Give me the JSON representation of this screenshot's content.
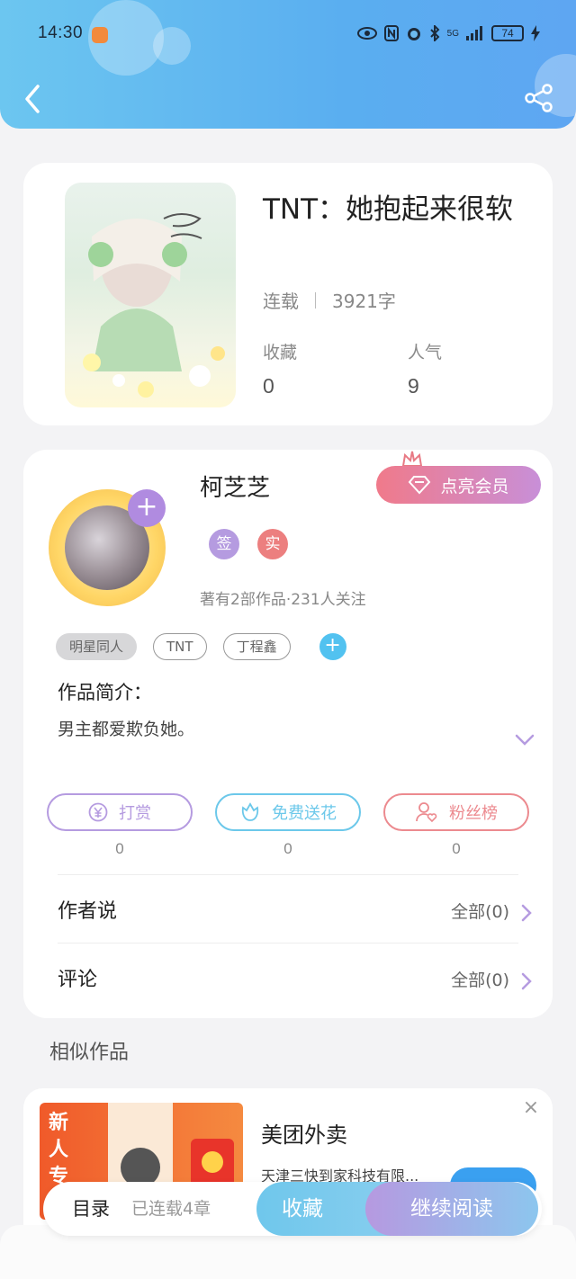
{
  "status_bar": {
    "time": "14:30",
    "network": "5G",
    "battery": "74"
  },
  "book": {
    "title": "TNT：她抱起来很软",
    "status": "连载",
    "word_count": "3921字",
    "collect_label": "收藏",
    "collect_value": "0",
    "popularity_label": "人气",
    "popularity_value": "9"
  },
  "author": {
    "name": "柯芝芝",
    "member_button": "点亮会员",
    "badge_sign": "签",
    "badge_real": "实",
    "stats": "著有2部作品·231人关注",
    "tags": [
      "明星同人",
      "TNT",
      "丁程鑫"
    ],
    "intro_title": "作品简介：",
    "intro_text": "男主都爱欺负她。"
  },
  "actions": [
    {
      "label": "打赏",
      "count": "0",
      "color": "#b59be0"
    },
    {
      "label": "免费送花",
      "count": "0",
      "color": "#6cc8ea"
    },
    {
      "label": "粉丝榜",
      "count": "0",
      "color": "#ec8a8f"
    }
  ],
  "rows": {
    "author_says": {
      "label": "作者说",
      "value": "全部(0)"
    },
    "comments": {
      "label": "评论",
      "value": "全部(0)"
    }
  },
  "similar": {
    "title": "相似作品"
  },
  "ad": {
    "title": "美团外卖",
    "subtitle": "天津三快到家科技有限...",
    "promo": "新人专"
  },
  "bottom": {
    "catalog": "目录",
    "chapters": "已连载4章",
    "favorite": "收藏",
    "continue": "继续阅读"
  },
  "colors": {
    "header": "#5aaef0",
    "accent_purple": "#b08be0",
    "accent_blue": "#52c2f0"
  }
}
